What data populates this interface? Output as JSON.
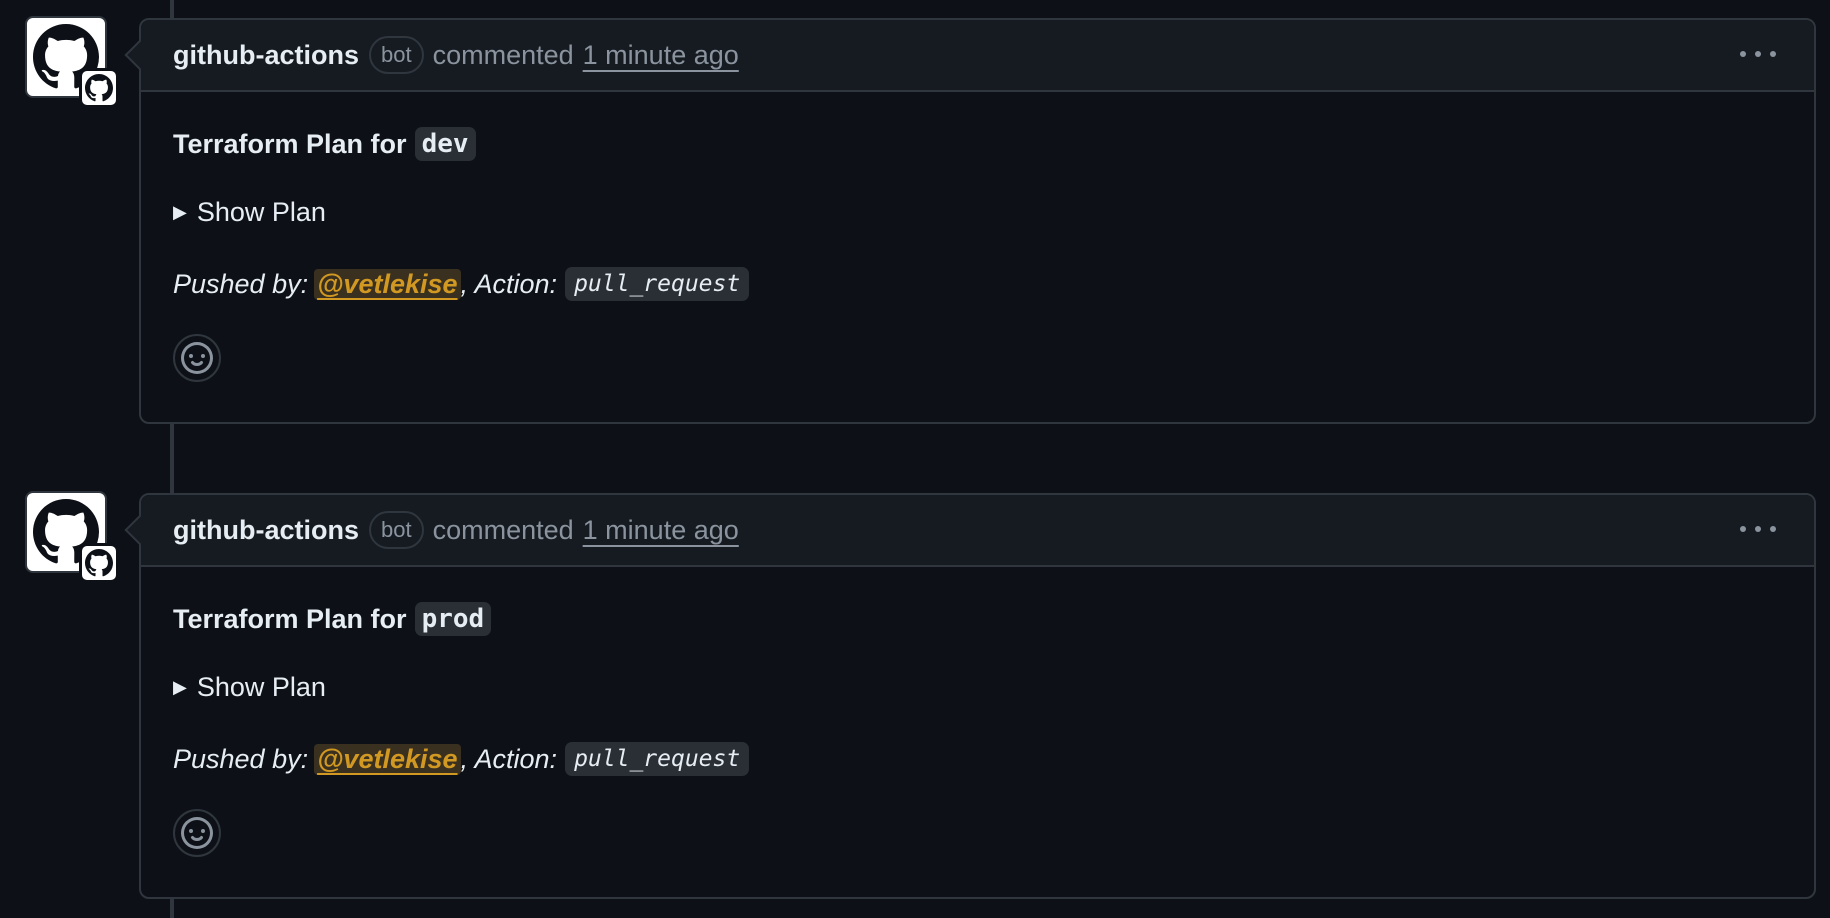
{
  "comments": [
    {
      "author": "github-actions",
      "author_badge": "bot",
      "commented_label": "commented",
      "timestamp": "1 minute ago",
      "title_prefix": "Terraform Plan for",
      "environment": "dev",
      "toggle_label": "Show Plan",
      "pushed_by_label": "Pushed by:",
      "pushed_by_user": "@vetlekise",
      "action_label": ", Action:",
      "action_value": "pull_request"
    },
    {
      "author": "github-actions",
      "author_badge": "bot",
      "commented_label": "commented",
      "timestamp": "1 minute ago",
      "title_prefix": "Terraform Plan for",
      "environment": "prod",
      "toggle_label": "Show Plan",
      "pushed_by_label": "Pushed by:",
      "pushed_by_user": "@vetlekise",
      "action_label": ", Action:",
      "action_value": "pull_request"
    }
  ],
  "icons": {
    "avatar": "github-octocat-icon",
    "badge": "github-app-badge-icon",
    "more": "kebab-menu-icon",
    "reaction": "smiley-icon",
    "toggle": "disclosure-triangle-icon"
  },
  "colors": {
    "background": "#0d1117",
    "header": "#161b22",
    "border": "#30363d",
    "muted": "#8b949e",
    "mention": "#d29922"
  }
}
